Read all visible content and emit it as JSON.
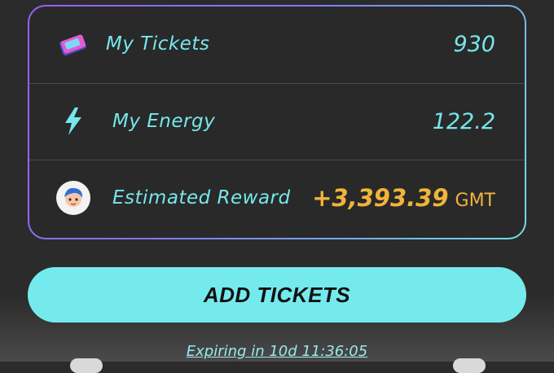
{
  "stats": {
    "tickets": {
      "label": "My Tickets",
      "value": "930",
      "icon": "ticket-icon"
    },
    "energy": {
      "label": "My Energy",
      "value": "122.2",
      "icon": "lightning-bolt-icon"
    },
    "reward": {
      "label": "Estimated Reward",
      "amount": "+3,393.39",
      "unit": "GMT",
      "icon": "avatar-icon"
    }
  },
  "action": {
    "add_tickets_label": "ADD TICKETS"
  },
  "footer": {
    "expiring_text": "Expiring in 10d 11:36:05"
  },
  "colors": {
    "accent_cyan": "#74eaec",
    "reward_gold": "#f0b43b",
    "border_purple": "#9b5cf0"
  }
}
